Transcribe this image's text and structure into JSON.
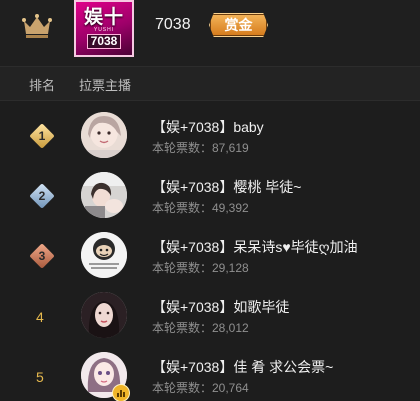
{
  "header": {
    "crown_icon": "crown-icon",
    "brand": {
      "line1": "娱十",
      "line2": "YUSHI",
      "line3": "7038"
    },
    "host_id": "7038",
    "reward_label": "赏金"
  },
  "columns": {
    "rank": "排名",
    "host": "拉票主播"
  },
  "rows": [
    {
      "rank": "1",
      "badge": "gold",
      "name": "【娱+7038】baby",
      "votes": "本轮票数：87,619"
    },
    {
      "rank": "2",
      "badge": "silver",
      "name": "【娱+7038】樱桃 毕徒~",
      "votes": "本轮票数：49,392"
    },
    {
      "rank": "3",
      "badge": "bronze",
      "name": "【娱+7038】呆呆诗s♥毕徒ღ加油",
      "votes": "本轮票数：29,128"
    },
    {
      "rank": "4",
      "badge": "plain",
      "name": "【娱+7038】如歌毕徒",
      "votes": "本轮票数：28,012"
    },
    {
      "rank": "5",
      "badge": "plain",
      "name": "【娱+7038】佳 肴 求公会票~",
      "votes": "本轮票数：20,764"
    }
  ],
  "colors": {
    "background": "#1d1d1d",
    "rank_text": "#e6b94e",
    "reward_badge": "#e0952f",
    "brand": "#c8007a"
  }
}
